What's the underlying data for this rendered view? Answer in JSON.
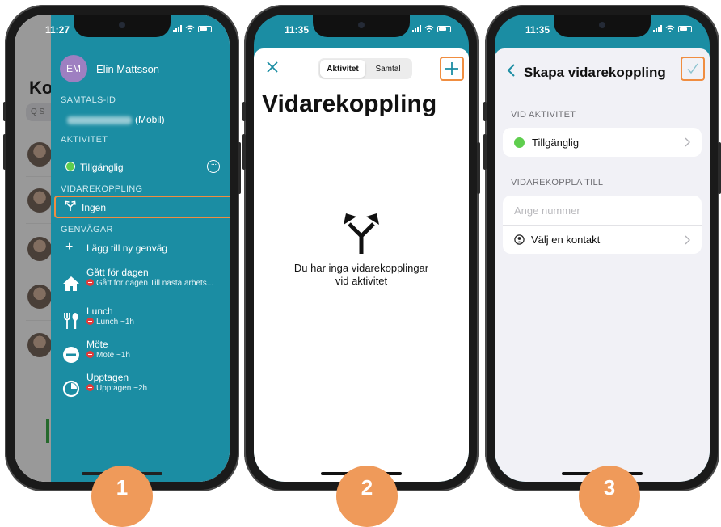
{
  "colors": {
    "teal": "#1b8da3",
    "highlight_orange": "#f08d40",
    "badge_orange": "#ef9a5a",
    "status_green": "#5fce4e",
    "busy_red": "#e13b3b",
    "avatar_purple": "#9e7fc1"
  },
  "phone1": {
    "time": "11:27",
    "background_title": "Ko",
    "background_search": "Q S",
    "user": {
      "initials": "EM",
      "name": "Elin Mattsson"
    },
    "sections": {
      "samtals_id": "SAMTALS-ID",
      "aktivitet": "AKTIVITET",
      "vidarekoppling": "VIDAREKOPPLING",
      "genvagar": "GENVÄGAR"
    },
    "phone_suffix": "(Mobil)",
    "activity": "Tillgänglig",
    "forwarding": "Ingen",
    "add_shortcut": "Lägg till ny genväg",
    "shortcuts": [
      {
        "icon": "house-icon",
        "title": "Gått för dagen",
        "subtitle": "Gått för dagen Till nästa arbets..."
      },
      {
        "icon": "cutlery-icon",
        "title": "Lunch",
        "subtitle": "Lunch ~1h"
      },
      {
        "icon": "minus-circle-icon",
        "title": "Möte",
        "subtitle": "Möte ~1h"
      },
      {
        "icon": "clock-icon",
        "title": "Upptagen",
        "subtitle": "Upptagen ~2h"
      }
    ]
  },
  "phone2": {
    "time": "11:35",
    "segments": [
      "Aktivitet",
      "Samtal"
    ],
    "title": "Vidarekoppling",
    "empty_line1": "Du har inga vidarekopplingar",
    "empty_line2": "vid aktivitet"
  },
  "phone3": {
    "time": "11:35",
    "title": "Skapa vidarekoppling",
    "section_activity": "VID AKTIVITET",
    "activity_value": "Tillgänglig",
    "section_forward": "VIDAREKOPPLA TILL",
    "number_placeholder": "Ange nummer",
    "choose_contact": "Välj en kontakt"
  },
  "badges": [
    "1",
    "2",
    "3"
  ]
}
